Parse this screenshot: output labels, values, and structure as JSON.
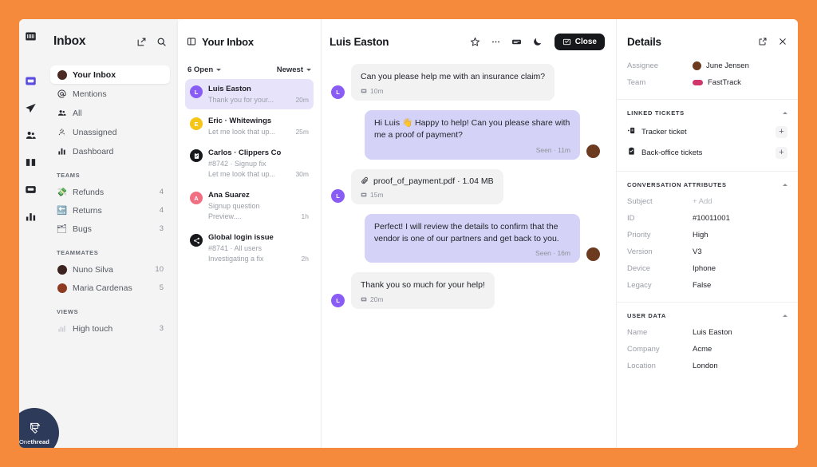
{
  "theme": {
    "accent": "#5b4ce0",
    "frame_border": "#f58a3c",
    "bubble_out": "#d5d2f7",
    "bubble_in": "#f2f2f3",
    "selected_row": "#e6e3fb",
    "dark_button": "#17181c"
  },
  "logo": {
    "name_light": "One",
    "name_bold": "thread"
  },
  "rail": {
    "items": [
      {
        "name": "workspace-icon",
        "active": false
      },
      {
        "name": "inbox-icon",
        "active": true
      },
      {
        "name": "send-icon",
        "active": false
      },
      {
        "name": "contacts-icon",
        "active": false
      },
      {
        "name": "knowledge-icon",
        "active": false
      },
      {
        "name": "messenger-icon",
        "active": false
      },
      {
        "name": "reports-icon",
        "active": false
      }
    ]
  },
  "sidebar": {
    "title": "Inbox",
    "actions": [
      {
        "name": "compose-icon",
        "label": "Compose"
      },
      {
        "name": "search-icon",
        "label": "Search"
      }
    ],
    "items": [
      {
        "label": "Your Inbox",
        "icon": "avatar",
        "selected": true,
        "count": ""
      },
      {
        "label": "Mentions",
        "icon": "at",
        "selected": false,
        "count": ""
      },
      {
        "label": "All",
        "icon": "people",
        "selected": false,
        "count": ""
      },
      {
        "label": "Unassigned",
        "icon": "person-dashed",
        "selected": false,
        "count": ""
      },
      {
        "label": "Dashboard",
        "icon": "bars",
        "selected": false,
        "count": ""
      }
    ],
    "groups": [
      {
        "label": "TEAMS",
        "items": [
          {
            "label": "Refunds",
            "icon": "money",
            "count": "4"
          },
          {
            "label": "Returns",
            "icon": "return",
            "count": "4"
          },
          {
            "label": "Bugs",
            "icon": "bug",
            "count": "3"
          }
        ]
      },
      {
        "label": "TEAMMATES",
        "items": [
          {
            "label": "Nuno Silva",
            "icon": "avatar",
            "color": "#3d2320",
            "count": "10"
          },
          {
            "label": "Maria Cardenas",
            "icon": "avatar",
            "color": "#8e3a22",
            "count": "5"
          }
        ]
      },
      {
        "label": "VIEWS",
        "items": [
          {
            "label": "High touch",
            "icon": "chart",
            "count": "3"
          }
        ]
      }
    ]
  },
  "conversation_list": {
    "title": "Your Inbox",
    "header_icon": "panel-icon",
    "filter": {
      "label": "6 Open",
      "name": "status-filter"
    },
    "sort": {
      "label": "Newest",
      "name": "sort-filter"
    },
    "items": [
      {
        "name": "Luis Easton",
        "sub": "",
        "preview": "Thank you for your...",
        "time": "20m",
        "active": true,
        "avatar_letter": "L",
        "avatar_color": "#8a5cf6",
        "avatar_icon": ""
      },
      {
        "name": "Eric · Whitewings",
        "sub": "",
        "preview": "Let me look that up...",
        "time": "25m",
        "active": false,
        "avatar_letter": "E",
        "avatar_color": "#f5c518",
        "avatar_icon": ""
      },
      {
        "name": "Carlos · Clippers Co",
        "sub": "#8742  ·  Signup fix",
        "preview": "Let me look that up...",
        "time": "30m",
        "active": false,
        "avatar_letter": "",
        "avatar_color": "#17181c",
        "avatar_icon": "clipboard"
      },
      {
        "name": "Ana Suarez",
        "sub": "Signup question",
        "preview": "Preview....",
        "time": "1h",
        "active": false,
        "avatar_letter": "A",
        "avatar_color": "#f07082",
        "avatar_icon": ""
      },
      {
        "name": "Global login issue",
        "sub": "#8741 · All users",
        "preview": "Investigating a fix",
        "time": "2h",
        "active": false,
        "avatar_letter": "",
        "avatar_color": "#17181c",
        "avatar_icon": "share"
      }
    ]
  },
  "conversation": {
    "title": "Luis Easton",
    "actions": [
      {
        "name": "star-icon",
        "label": "Star"
      },
      {
        "name": "more-icon",
        "label": "More"
      },
      {
        "name": "snippet-icon",
        "label": "Snippet"
      },
      {
        "name": "snooze-icon",
        "label": "Snooze"
      }
    ],
    "close_button": "Close",
    "messages": [
      {
        "direction": "in",
        "text": "Can you please help me with an insurance claim?",
        "meta": "10m",
        "meta_icon": "channel-icon",
        "avatar_letter": "L",
        "avatar_color": "#8a5cf6",
        "type": "text"
      },
      {
        "direction": "out",
        "text": "Hi Luis 👋 Happy to help! Can you please share with me a proof of payment?",
        "meta": "Seen · 11m",
        "avatar_color": "#6b3a1f",
        "type": "text"
      },
      {
        "direction": "in",
        "text": "proof_of_payment.pdf · 1.04 MB",
        "meta": "15m",
        "meta_icon": "channel-icon",
        "avatar_letter": "L",
        "avatar_color": "#8a5cf6",
        "type": "file"
      },
      {
        "direction": "out",
        "text": "Perfect! I will review the details to confirm that the vendor is one of our partners and get back to you.",
        "meta": "Seen · 16m",
        "avatar_color": "#6b3a1f",
        "type": "text"
      },
      {
        "direction": "in",
        "text": "Thank you so much for your help!",
        "meta": "20m",
        "meta_icon": "channel-icon",
        "avatar_letter": "L",
        "avatar_color": "#8a5cf6",
        "type": "text"
      }
    ]
  },
  "details": {
    "title": "Details",
    "actions": [
      {
        "name": "open-external-icon",
        "label": "Open"
      },
      {
        "name": "close-icon",
        "label": "Close"
      }
    ],
    "top_rows": [
      {
        "label": "Assignee",
        "value": "June Jensen",
        "marker": "avatar",
        "color": "#6b3a1f"
      },
      {
        "label": "Team",
        "value": "FastTrack",
        "marker": "pill",
        "color": "#d0356b"
      }
    ],
    "linked_tickets": {
      "header": "LINKED TICKETS",
      "items": [
        {
          "label": "Tracker ticket",
          "icon": "tracker-icon",
          "action": "+"
        },
        {
          "label": "Back-office tickets",
          "icon": "backoffice-icon",
          "action": "+"
        }
      ]
    },
    "conversation_attributes": {
      "header": "CONVERSATION ATTRIBUTES",
      "rows": [
        {
          "label": "Subject",
          "value": "+ Add",
          "muted": true
        },
        {
          "label": "ID",
          "value": "#10011001",
          "muted": false
        },
        {
          "label": "Priority",
          "value": "High",
          "muted": false
        },
        {
          "label": "Version",
          "value": "V3",
          "muted": false
        },
        {
          "label": "Device",
          "value": "Iphone",
          "muted": false
        },
        {
          "label": "Legacy",
          "value": "False",
          "muted": false
        }
      ]
    },
    "user_data": {
      "header": "USER DATA",
      "rows": [
        {
          "label": "Name",
          "value": "Luis Easton"
        },
        {
          "label": "Company",
          "value": "Acme"
        },
        {
          "label": "Location",
          "value": "London"
        }
      ]
    }
  }
}
